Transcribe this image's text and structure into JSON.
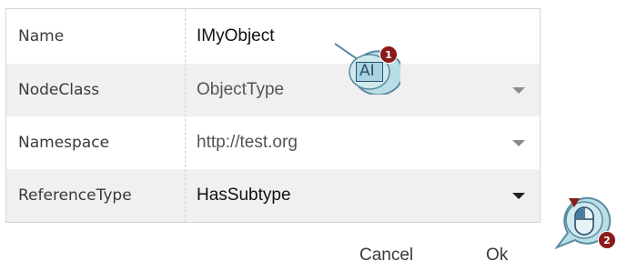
{
  "form": {
    "rows": [
      {
        "label": "Name",
        "value": "IMyObject",
        "has_dropdown": false
      },
      {
        "label": "NodeClass",
        "value": "ObjectType",
        "has_dropdown": true
      },
      {
        "label": "Namespace",
        "value": "http://test.org",
        "has_dropdown": true
      },
      {
        "label": "ReferenceType",
        "value": "HasSubtype",
        "has_dropdown": true
      }
    ]
  },
  "actions": {
    "cancel_label": "Cancel",
    "ok_label": "Ok"
  },
  "annotations": {
    "step1": {
      "badge": "1",
      "icon": "text-cursor-icon",
      "glyph": "AI"
    },
    "step2": {
      "badge": "2",
      "icon": "mouse-icon"
    }
  },
  "colors": {
    "row_shade": "#f0f0f0",
    "callout_fill": "#b9dfe6",
    "callout_stroke": "#5a8aa0",
    "badge": "#8b1a1a"
  }
}
